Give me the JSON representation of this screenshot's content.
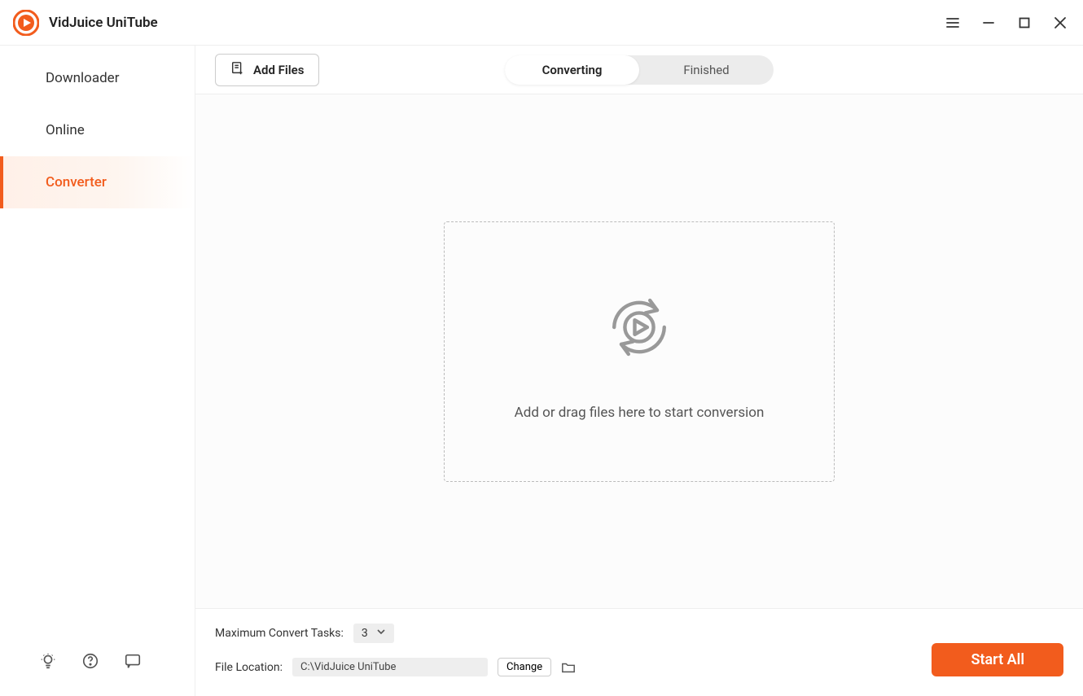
{
  "app": {
    "title": "VidJuice UniTube"
  },
  "sidebar": {
    "items": [
      {
        "label": "Downloader"
      },
      {
        "label": "Online"
      },
      {
        "label": "Converter"
      }
    ]
  },
  "toolbar": {
    "add_files_label": "Add Files"
  },
  "tabs": {
    "converting": "Converting",
    "finished": "Finished"
  },
  "dropzone": {
    "text": "Add or drag files here to start conversion"
  },
  "bottom": {
    "max_tasks_label": "Maximum Convert Tasks:",
    "max_tasks_value": "3",
    "file_location_label": "File Location:",
    "file_location_value": "C:\\VidJuice UniTube",
    "change_label": "Change",
    "start_all_label": "Start All"
  }
}
